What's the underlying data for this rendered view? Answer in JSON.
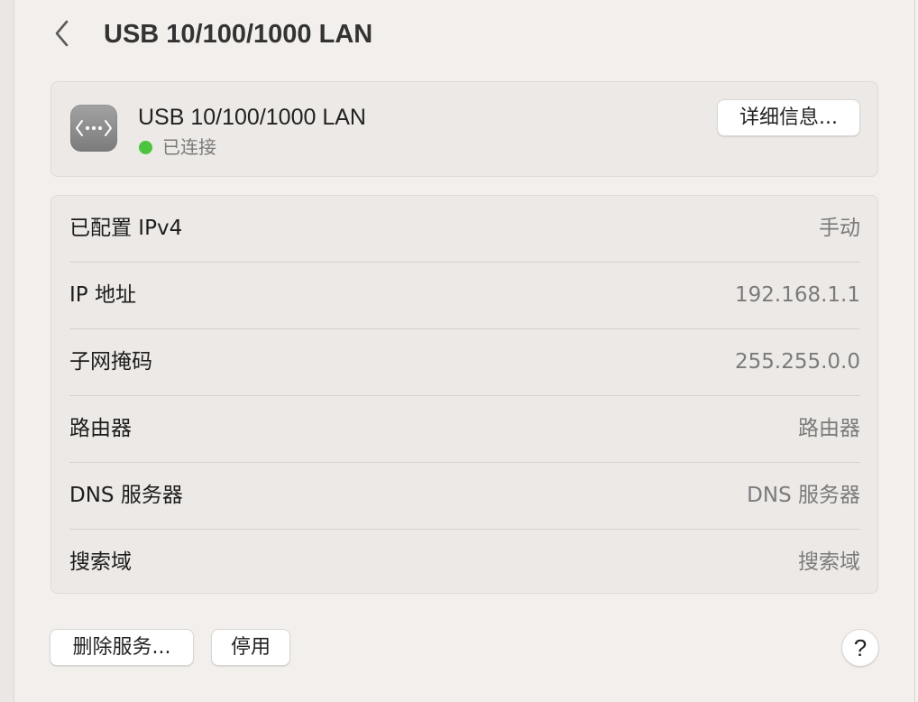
{
  "header": {
    "back_icon": "chevron-left-icon",
    "title": "USB 10/100/1000 LAN"
  },
  "interface": {
    "icon": "ethernet-icon",
    "name": "USB 10/100/1000 LAN",
    "status": "已连接",
    "status_color": "#4cc53e",
    "details_label": "详细信息..."
  },
  "info_rows": [
    {
      "label": "已配置 IPv4",
      "value": "手动"
    },
    {
      "label": "IP 地址",
      "value": "192.168.1.1"
    },
    {
      "label": "子网掩码",
      "value": "255.255.0.0"
    },
    {
      "label": "路由器",
      "value": "路由器"
    },
    {
      "label": "DNS 服务器",
      "value": "DNS 服务器"
    },
    {
      "label": "搜索域",
      "value": "搜索域"
    }
  ],
  "footer": {
    "delete_label": "删除服务...",
    "disable_label": "停用",
    "help_label": "?"
  }
}
